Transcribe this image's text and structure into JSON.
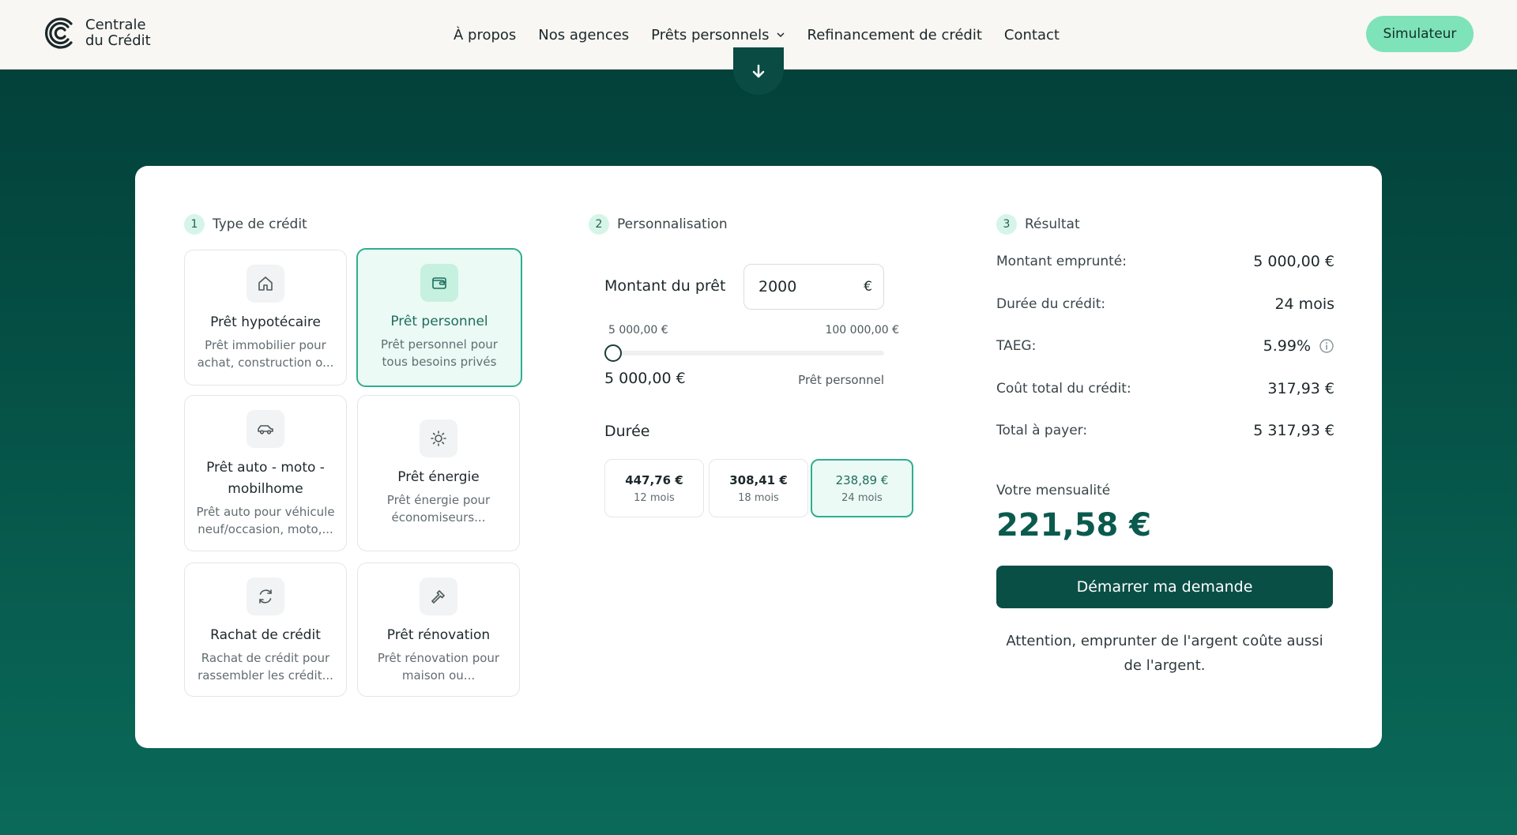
{
  "header": {
    "logo_line1": "Centrale",
    "logo_line2": "du Crédit",
    "nav": [
      "À propos",
      "Nos agences",
      "Prêts personnels",
      "Refinancement de crédit",
      "Contact"
    ],
    "cta": "Simulateur"
  },
  "steps": {
    "s1": {
      "num": "1",
      "title": "Type de crédit"
    },
    "s2": {
      "num": "2",
      "title": "Personnalisation"
    },
    "s3": {
      "num": "3",
      "title": "Résultat"
    }
  },
  "credit_types": [
    {
      "title": "Prêt hypotécaire",
      "desc1": "Prêt immobilier pour",
      "desc2": "achat, construction o...",
      "icon": "home-icon"
    },
    {
      "title": "Prêt personnel",
      "desc1": "Prêt personnel pour",
      "desc2": "tous besoins privés",
      "icon": "wallet-icon",
      "selected": true
    },
    {
      "title1": "Prêt auto - moto -",
      "title2": "mobilhome",
      "desc1": "Prêt auto pour véhicule",
      "desc2": "neuf/occasion, moto,...",
      "icon": "car-icon"
    },
    {
      "title": "Prêt énergie",
      "desc1": "Prêt énergie pour",
      "desc2": "économiseurs...",
      "icon": "sun-icon"
    },
    {
      "title": "Rachat de crédit",
      "desc1": "Rachat de crédit pour",
      "desc2": "rassembler les crédit...",
      "icon": "refresh-icon"
    },
    {
      "title": "Prêt rénovation",
      "desc1": "Prêt rénovation pour",
      "desc2": "maison ou...",
      "icon": "hammer-icon"
    }
  ],
  "personalisation": {
    "amount_label": "Montant du prêt",
    "amount_value": "2000",
    "currency": "€",
    "range_min": "5 000,00 €",
    "range_max": "100 000,00 €",
    "slider_value": "5 000,00 €",
    "slider_level": 0,
    "slider_type": "Prêt personnel",
    "duration_label": "Durée",
    "durations": [
      {
        "amount": "447,76 €",
        "months": "12 mois"
      },
      {
        "amount": "308,41 €",
        "months": "18 mois"
      },
      {
        "amount": "238,89 €",
        "months": "24 mois",
        "selected": true
      }
    ]
  },
  "result": {
    "rows": [
      {
        "label": "Montant emprunté:",
        "value": "5 000,00 €"
      },
      {
        "label": "Durée du crédit:",
        "value": "24 mois"
      },
      {
        "label": "TAEG:",
        "value": "5.99%"
      },
      {
        "label": "Coût total du crédit:",
        "value": "317,93 €"
      },
      {
        "label": "Total à payer:",
        "value": "5 317,93 €"
      }
    ],
    "monthly_label": "Votre mensualité",
    "monthly_value": "221,58 €",
    "start_button": "Démarrer ma demande",
    "warning": "Attention, emprunter de l'argent coûte aussi de l'argent."
  },
  "colors": {
    "brand_dark": "#0a4f46",
    "accent": "#2fae8f",
    "cta_mint": "#7ee3b8"
  }
}
